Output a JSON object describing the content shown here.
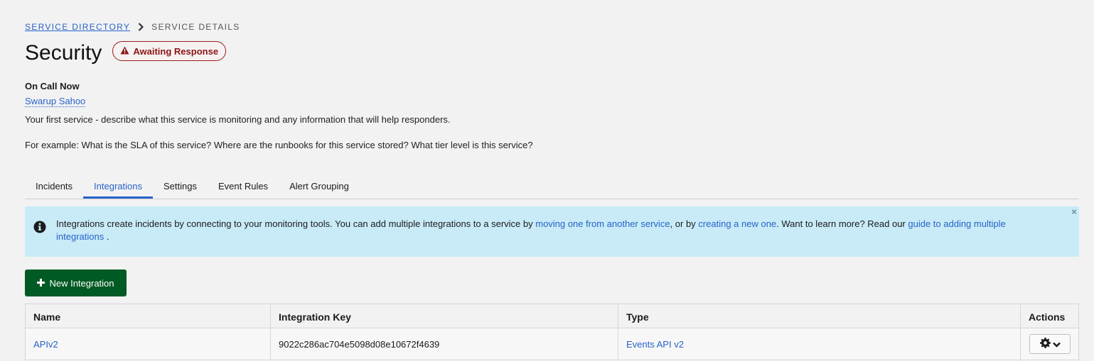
{
  "breadcrumb": {
    "link_label": "SERVICE DIRECTORY",
    "current_label": "SERVICE DETAILS"
  },
  "page": {
    "title": "Security",
    "status_badge": "Awaiting Response",
    "oncall_label": "On Call Now",
    "oncall_user": "Swarup Sahoo",
    "description_line1": "Your first service - describe what this service is monitoring and any information that will help responders.",
    "description_line2": "For example: What is the SLA of this service? Where are the runbooks for this service stored? What tier level is this service?"
  },
  "tabs": [
    {
      "label": "Incidents",
      "active": false
    },
    {
      "label": "Integrations",
      "active": true
    },
    {
      "label": "Settings",
      "active": false
    },
    {
      "label": "Event Rules",
      "active": false
    },
    {
      "label": "Alert Grouping",
      "active": false
    }
  ],
  "info_banner": {
    "text_before": "Integrations create incidents by connecting to your monitoring tools. You can add multiple integrations to a service by ",
    "link1": "moving one from another service",
    "text_mid1": ", or by ",
    "link2": "creating a new one",
    "text_mid2": ". Want to learn more? Read our ",
    "link3": "guide to adding multiple integrations",
    "text_end": " .",
    "close_symbol": "×"
  },
  "new_integration_button": {
    "label": "New Integration"
  },
  "integrations_table": {
    "columns": [
      "Name",
      "Integration Key",
      "Type",
      "Actions"
    ],
    "rows": [
      {
        "name": "APIv2",
        "key": "9022c286ac704e5098d08e10672f4639",
        "type": "Events API v2"
      }
    ]
  },
  "colors": {
    "link": "#2762c9",
    "badge_red": "#8b1414",
    "banner_bg": "#c8ebf7",
    "primary_button": "#005a24"
  },
  "icons": {
    "breadcrumb_separator": "chevron-right-icon",
    "badge": "warning-triangle-icon",
    "banner": "info-circle-icon",
    "button": "plus-icon",
    "actions": "gear-icon"
  }
}
